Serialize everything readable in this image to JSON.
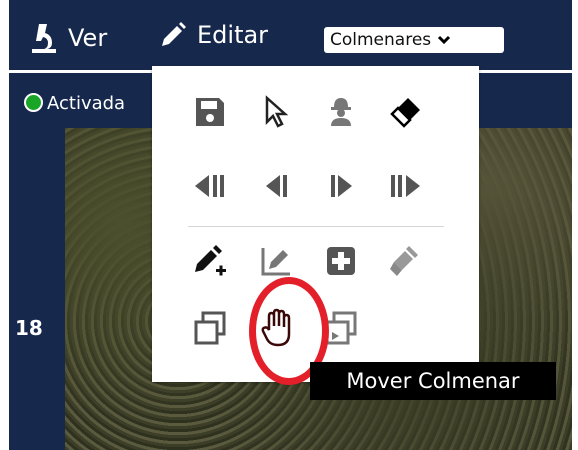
{
  "topbar": {
    "ver_label": "Ver",
    "edit_label": "Editar",
    "apiary_select": {
      "value": "Colmenares"
    }
  },
  "status": {
    "label": "Activada",
    "color": "#19a626"
  },
  "map": {
    "zoom_level": "18"
  },
  "toolbar": {
    "row1": [
      "save-icon",
      "cursor-icon",
      "worker-icon",
      "eraser-icon"
    ],
    "row2": [
      "first-icon",
      "previous-icon",
      "next-icon",
      "last-icon"
    ],
    "row3": [
      "edit-add-icon",
      "edit-icon",
      "add-box-icon",
      "brush-icon"
    ],
    "row4": [
      "copy-icon",
      "hand-icon",
      "copy-variant-icon"
    ]
  },
  "tooltip": {
    "text": "Mover Colmenar"
  },
  "colors": {
    "navbar": "#17284d",
    "highlight": "#e3202a",
    "icon_active": "#222222",
    "icon_inactive": "#555555"
  }
}
